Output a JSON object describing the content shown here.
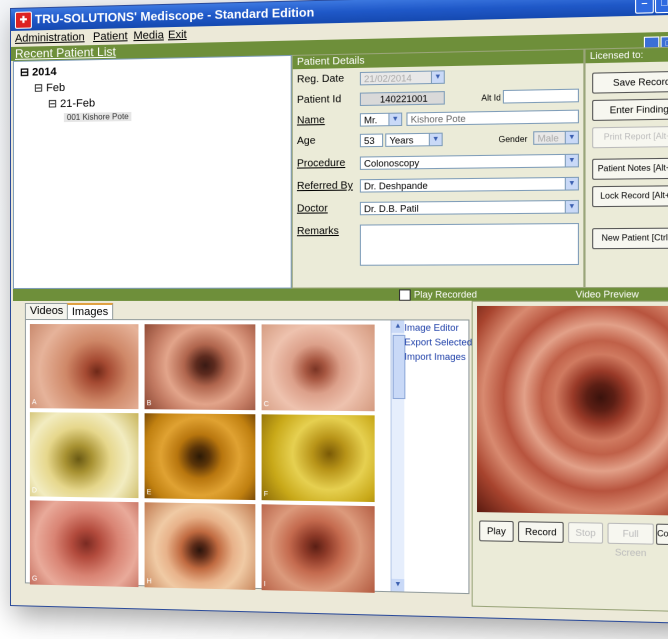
{
  "window": {
    "title": "TRU-SOLUTIONS' Mediscope - Standard Edition"
  },
  "menu": [
    {
      "label": "Administration"
    },
    {
      "label": "Patient"
    },
    {
      "label": "Media"
    },
    {
      "label": "Exit"
    }
  ],
  "recent_list": {
    "header": "Recent Patient List",
    "tree": {
      "year": "2014",
      "month": "Feb",
      "day": "21-Feb",
      "patient": "001  Kishore  Pote"
    }
  },
  "patient_details": {
    "header": "Patient Details",
    "reg_date": {
      "label": "Reg. Date",
      "value": "21/02/2014"
    },
    "patient_id": {
      "label": "Patient Id",
      "value": "140221001"
    },
    "alt_id": {
      "label": "Alt Id",
      "value": ""
    },
    "name": {
      "label": "Name",
      "salutation": "Mr.",
      "value": "Kishore  Pote"
    },
    "age": {
      "label": "Age",
      "value": "53",
      "unit": "Years"
    },
    "gender": {
      "label": "Gender",
      "value": "Male"
    },
    "procedure": {
      "label": "Procedure",
      "value": "Colonoscopy"
    },
    "referred_by": {
      "label": "Referred By",
      "value": "Dr.  Deshpande"
    },
    "doctor": {
      "label": "Doctor",
      "value": "Dr.  D.B.  Patil"
    },
    "remarks": {
      "label": "Remarks",
      "value": ""
    }
  },
  "license": {
    "header": "Licensed to:",
    "buttons": [
      {
        "label": "Save Record"
      },
      {
        "label": "Enter Findings"
      },
      {
        "label": "Print Report [Alt+P]"
      },
      {
        "label": "Patient Notes [Alt+PN]"
      },
      {
        "label": "Lock Record [Alt+PL]"
      },
      {
        "label": "New Patient [Ctrl+N]"
      }
    ]
  },
  "bar": {
    "play_recorded": "Play Recorded",
    "video_preview": "Video Preview"
  },
  "media_tabs": [
    {
      "label": "Videos"
    },
    {
      "label": "Images"
    }
  ],
  "image_links": [
    "Image Editor",
    "Export Selected",
    "Import Images"
  ],
  "thumbs": [
    "A",
    "B",
    "C",
    "D",
    "E",
    "F",
    "G",
    "H",
    "I"
  ],
  "preview_buttons": [
    {
      "label": "Play"
    },
    {
      "label": "Record"
    },
    {
      "label": "Stop"
    },
    {
      "label": "Full Screen"
    },
    {
      "label": "Configure"
    }
  ],
  "colors": {
    "accent_green": "#6e8f3a",
    "titlebar_blue": "#1f58c8"
  }
}
